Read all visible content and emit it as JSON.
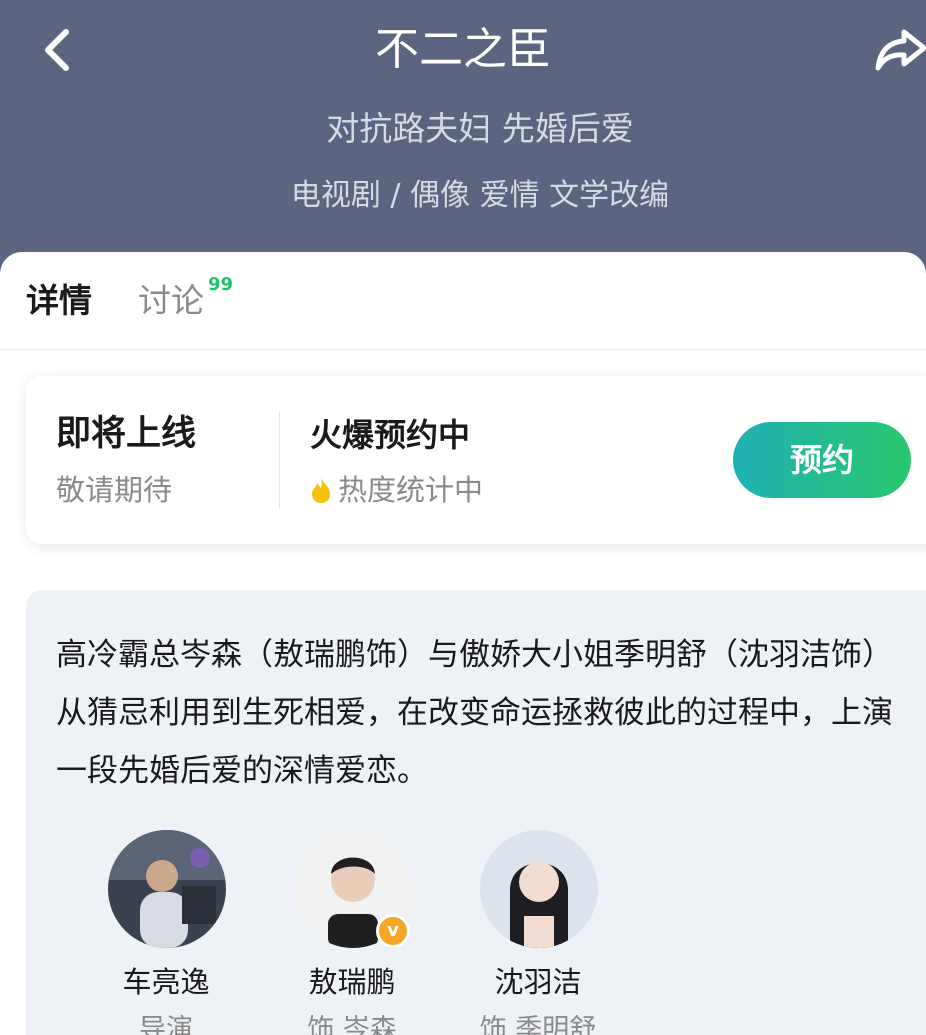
{
  "header": {
    "title": "不二之臣",
    "subtitle": "对抗路夫妇 先婚后爱",
    "genres": "电视剧 / 偶像 爱情 文学改编",
    "background_color": "#5b6580"
  },
  "tabs": {
    "detail": "详情",
    "discuss": "讨论",
    "discuss_badge": "99"
  },
  "status": {
    "main": "即将上线",
    "sub": "敬请期待",
    "hot_main": "火爆预约中",
    "hot_sub": "热度统计中",
    "reserve_label": "预约",
    "accent_color": "#28c86c"
  },
  "synopsis": "高冷霸总岑森（敖瑞鹏饰）与傲娇大小姐季明舒（沈羽洁饰）从猜忌利用到生死相爱，在改变命运拯救彼此的过程中，上演一段先婚后爱的深情爱恋。",
  "cast": [
    {
      "name": "车亮逸",
      "role": "导演"
    },
    {
      "name": "敖瑞鹏",
      "role": "饰 岑森",
      "verified": "v"
    },
    {
      "name": "沈羽洁",
      "role": "饰 季明舒"
    }
  ],
  "icons": [
    "back-arrow-icon",
    "share-icon",
    "flame-icon",
    "verified-icon"
  ]
}
